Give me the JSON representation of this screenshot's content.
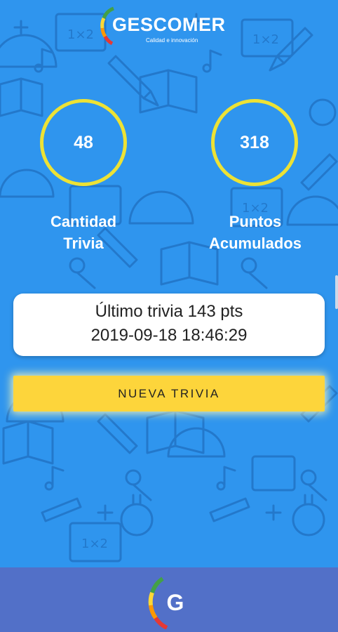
{
  "logo": {
    "name": "GESCOMER",
    "tagline": "Calidad e innovación"
  },
  "stats": [
    {
      "value": "48",
      "label_line1": "Cantidad",
      "label_line2": "Trivia"
    },
    {
      "value": "318",
      "label_line1": "Puntos",
      "label_line2": "Acumulados"
    }
  ],
  "last_trivia": {
    "line1": "Último trivia 143 pts",
    "line2": "2019-09-18 18:46:29"
  },
  "new_trivia_button": {
    "label": "NUEVA TRIVIA"
  },
  "bottom_bar": {
    "logo_letter": "G"
  },
  "colors": {
    "background": "#2F95EE",
    "ring": "#EDE235",
    "button": "#FDD53B",
    "bottom_bar": "#5270C8",
    "logo_arc": [
      "#E53935",
      "#FF9800",
      "#FDD835",
      "#43A047"
    ]
  }
}
